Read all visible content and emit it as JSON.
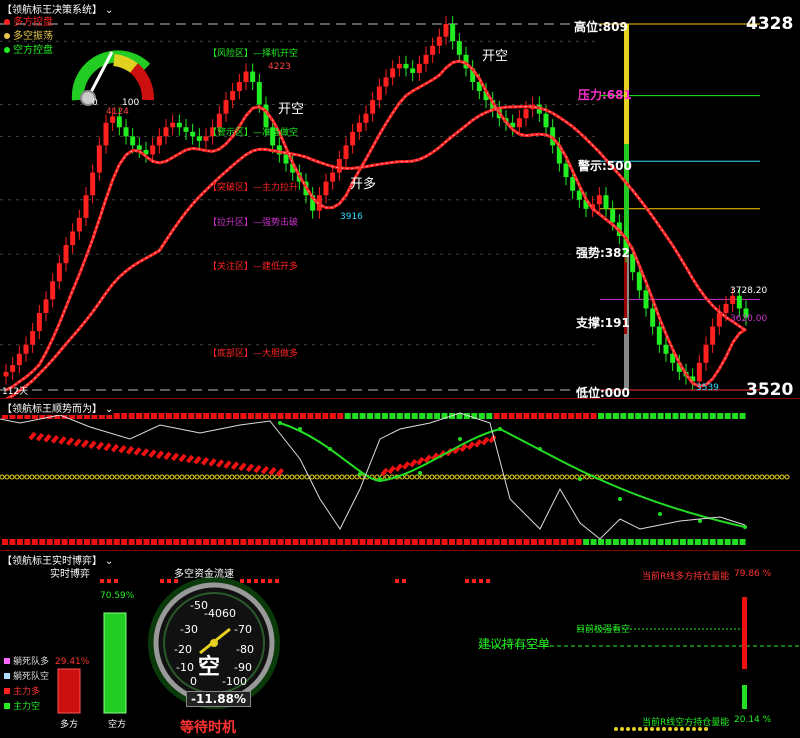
{
  "main_panel": {
    "title": "【领航标王决策系统】",
    "legend": [
      {
        "label": "多方控盘",
        "color": "#ff2020"
      },
      {
        "label": "多空振荡",
        "color": "#e6c84a"
      },
      {
        "label": "空方控盘",
        "color": "#22ee22"
      }
    ],
    "gauge": {
      "min_label": "0",
      "max_label": "100"
    },
    "price_high": "4328",
    "price_low": "3520",
    "bar_count": "112天",
    "levels": [
      {
        "label": "高位:809",
        "color": "#ffffff"
      },
      {
        "label": "压力:681",
        "color": "#ff33cc"
      },
      {
        "label": "警示:500",
        "color": "#ffffff"
      },
      {
        "label": "强势:382",
        "color": "#ffffff"
      },
      {
        "label": "支撑:191",
        "color": "#ffffff"
      },
      {
        "label": "低位:000",
        "color": "#ffffff"
      }
    ],
    "zones": [
      {
        "label": "【风险区】—择机开空",
        "color": "#22ee22"
      },
      {
        "label": "【警示区】—准备做空",
        "color": "#22ee22"
      },
      {
        "label": "【突破区】—主力拉升",
        "color": "#ff2222"
      },
      {
        "label": "【拉升区】—强势击破",
        "color": "#cc33cc"
      },
      {
        "label": "【关注区】—建低开多",
        "color": "#ff2222"
      },
      {
        "label": "【底部区】—大胆做多",
        "color": "#ff2222"
      }
    ],
    "signals": [
      {
        "text": "开空",
        "color": "#ffffff"
      },
      {
        "text": "开多",
        "color": "#ffffff"
      },
      {
        "text": "开空",
        "color": "#ffffff"
      }
    ],
    "price_marks": [
      {
        "text": "4223",
        "color": "#ff4444"
      },
      {
        "text": "4124",
        "color": "#ff4444"
      },
      {
        "text": "3916",
        "color": "#33ddff"
      },
      {
        "text": "3539",
        "color": "#33ddff"
      },
      {
        "text": "3728.20",
        "color": "#ffffff"
      },
      {
        "text": "3620.00",
        "color": "#cc33cc"
      }
    ]
  },
  "indicator_panel": {
    "title": "【领航标王顺势而为】"
  },
  "realtime_panel": {
    "title": "【领航标王实时博弈】",
    "subtitle": "实时博弈",
    "flow_title": "多空资金流速",
    "bull_pct": "29.41%",
    "bear_pct": "70.59%",
    "bar_labels": [
      "多方",
      "空方"
    ],
    "legend": [
      {
        "label": "躺死队多",
        "color": "#ff66ff"
      },
      {
        "label": "躺死队空",
        "color": "#aaddff"
      },
      {
        "label": "主力多",
        "color": "#ff2020"
      },
      {
        "label": "主力空",
        "color": "#22ee22"
      }
    ],
    "gauge_ticks": [
      "-50",
      "-40",
      "60",
      "-30",
      "-70",
      "-20",
      "-80",
      "-10",
      "-90",
      "0",
      "-100"
    ],
    "gauge_center": "空",
    "gauge_value": "-11.88%",
    "gauge_status": "等待时机",
    "advice": "建议持有空单",
    "trend": "目前极强看空",
    "bull_ability_label": "当前R线多方持仓量能",
    "bull_ability_value": "79.86 %",
    "bear_ability_label": "当前R线空方持仓量能",
    "bear_ability_value": "20.14 %"
  },
  "chart_data": {
    "type": "line",
    "title": "",
    "xlabel": "",
    "ylabel": "",
    "ylim": [
      3520,
      4328
    ],
    "x_count": 112,
    "series": [
      {
        "name": "",
        "values": [
          3560,
          3575,
          3600,
          3620,
          3650,
          3690,
          3720,
          3760,
          3800,
          3840,
          3870,
          3900,
          3950,
          4000,
          4060,
          4110,
          4124,
          4100,
          4080,
          4060,
          4050,
          4040,
          4060,
          4080,
          4100,
          4110,
          4100,
          4090,
          4080,
          4070,
          4080,
          4100,
          4130,
          4160,
          4180,
          4200,
          4223,
          4200,
          4150,
          4100,
          4060,
          4040,
          4020,
          4000,
          3980,
          3950,
          3916,
          3950,
          3980,
          4000,
          4030,
          4060,
          4090,
          4110,
          4130,
          4160,
          4190,
          4210,
          4230,
          4240,
          4230,
          4220,
          4240,
          4260,
          4280,
          4300,
          4328,
          4290,
          4260,
          4230,
          4200,
          4180,
          4160,
          4140,
          4120,
          4110,
          4100,
          4120,
          4140,
          4150,
          4130,
          4100,
          4060,
          4020,
          3990,
          3960,
          3940,
          3920,
          3930,
          3950,
          3920,
          3890,
          3860,
          3820,
          3780,
          3740,
          3700,
          3660,
          3620,
          3600,
          3580,
          3560,
          3550,
          3539,
          3580,
          3620,
          3660,
          3690,
          3710,
          3728,
          3700,
          3680
        ]
      }
    ]
  }
}
